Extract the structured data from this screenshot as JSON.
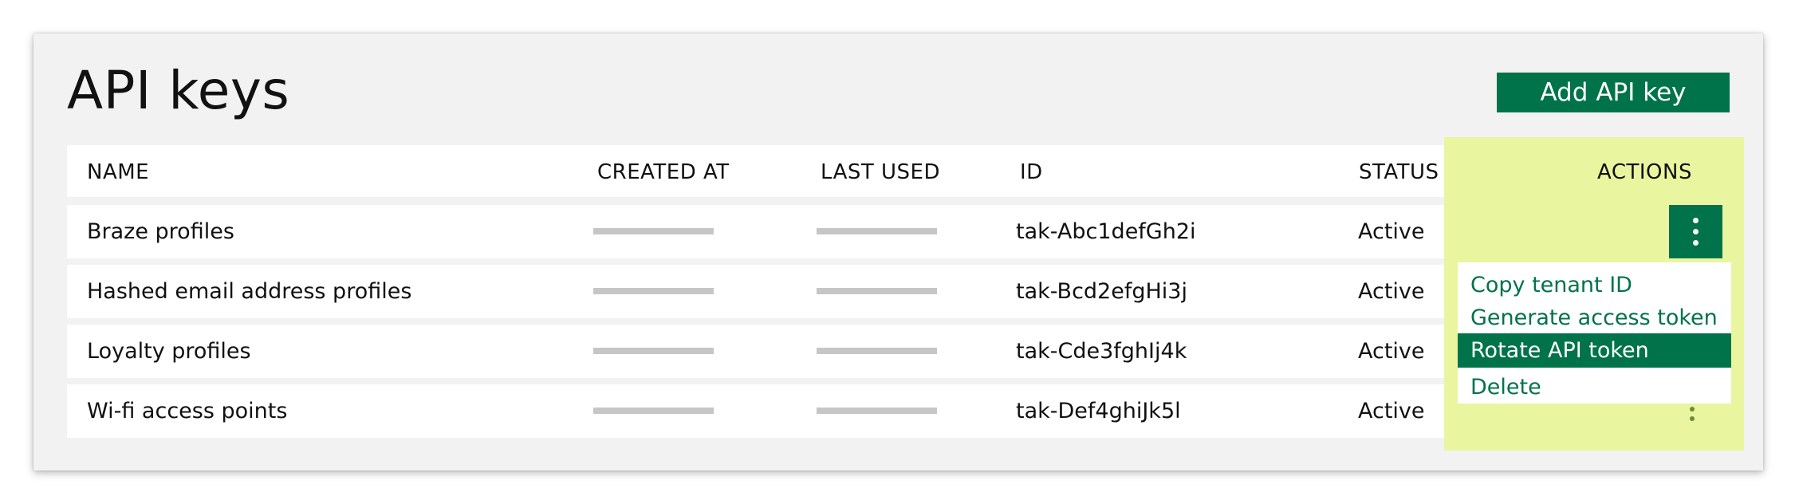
{
  "page": {
    "title": "API keys"
  },
  "toolbar": {
    "add_label": "Add API key"
  },
  "table": {
    "headers": {
      "name": "NAME",
      "created_at": "CREATED AT",
      "last_used": "LAST USED",
      "id": "ID",
      "status": "STATUS",
      "actions": "ACTIONS"
    },
    "rows": [
      {
        "name": "Braze profiles",
        "id": "tak-Abc1defGh2i",
        "status": "Active"
      },
      {
        "name": "Hashed email address profiles",
        "id": "tak-Bcd2efgHi3j",
        "status": "Active"
      },
      {
        "name": "Loyalty profiles",
        "id": "tak-Cde3fghIj4k",
        "status": "Active"
      },
      {
        "name": "Wi-fi access points",
        "id": "tak-Def4ghiJk5l",
        "status": "Active"
      }
    ]
  },
  "actions_menu": {
    "items": [
      {
        "label": "Copy tenant ID"
      },
      {
        "label": "Generate access token"
      },
      {
        "label": "Rotate API token"
      },
      {
        "label": "Delete"
      }
    ]
  },
  "colors": {
    "accent": "#00734a",
    "highlight": "#eaf5a0",
    "panel_bg": "#f1f2f1",
    "placeholder_bar": "#c6c6c6"
  },
  "icons": {
    "row_actions": "kebab-menu-icon"
  }
}
